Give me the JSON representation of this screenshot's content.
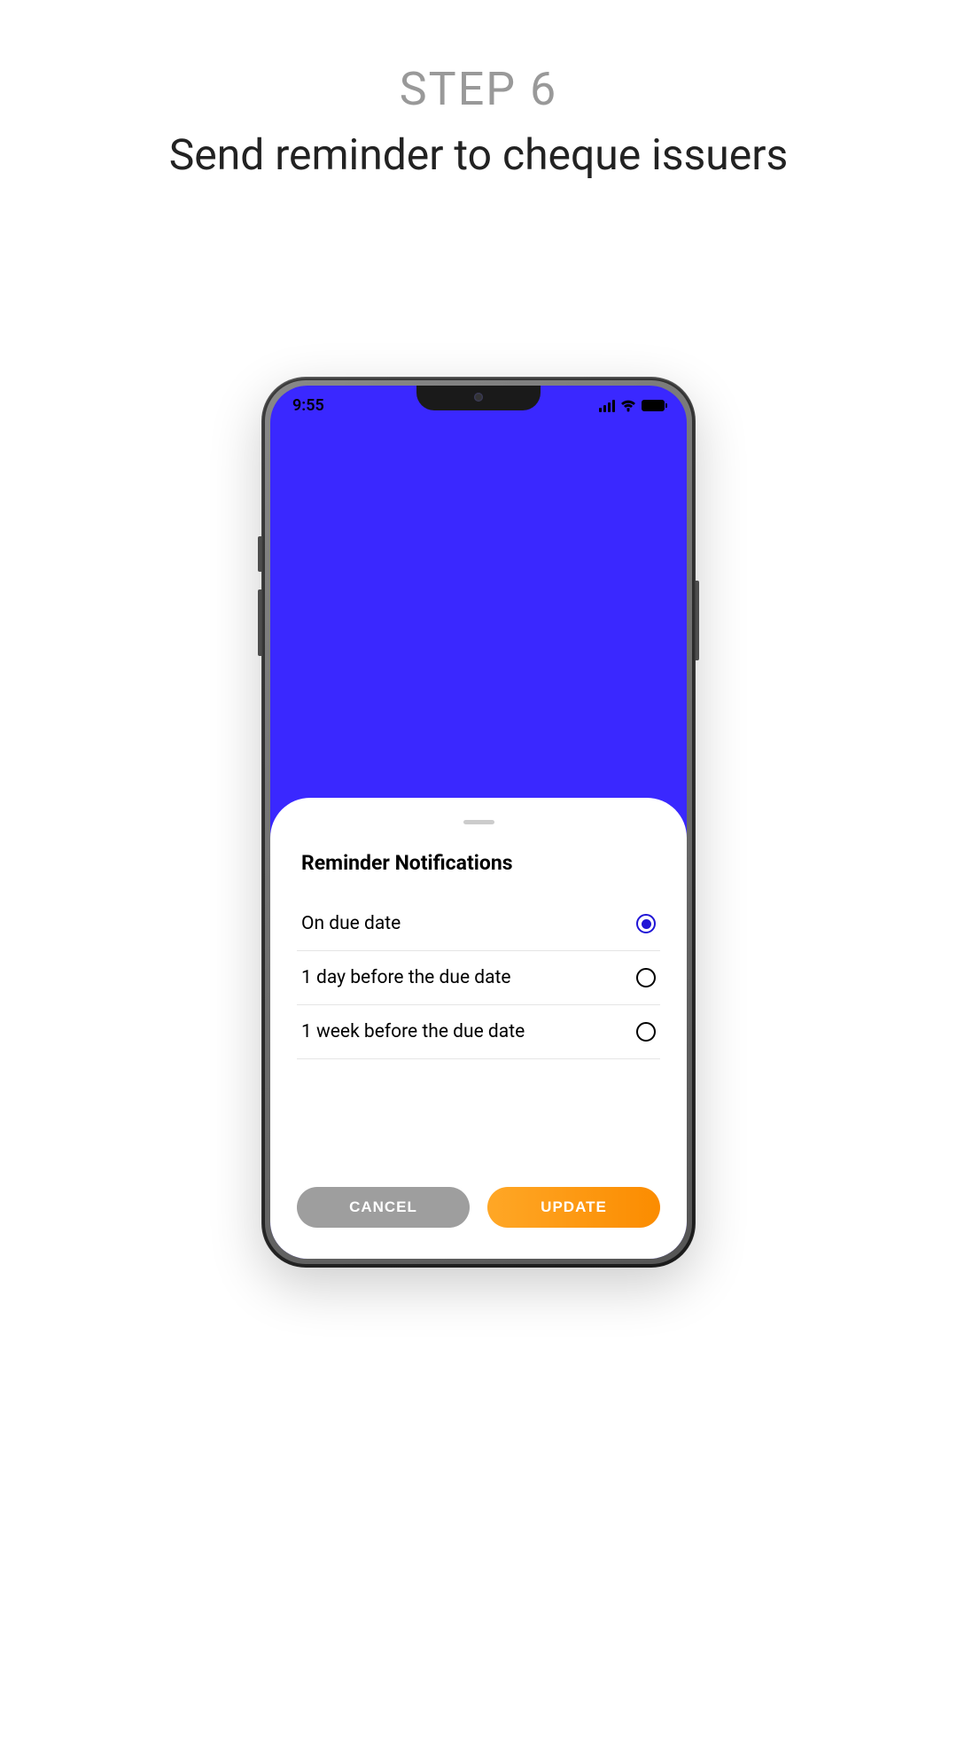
{
  "header": {
    "step_label": "STEP 6",
    "description": "Send reminder to cheque issuers"
  },
  "status_bar": {
    "time": "9:55"
  },
  "sheet": {
    "title": "Reminder Notifications",
    "options": [
      {
        "label": "On due date",
        "selected": true
      },
      {
        "label": "1 day before the due date",
        "selected": false
      },
      {
        "label": "1 week before the due date",
        "selected": false
      }
    ]
  },
  "buttons": {
    "cancel": "CANCEL",
    "update": "UPDATE"
  }
}
